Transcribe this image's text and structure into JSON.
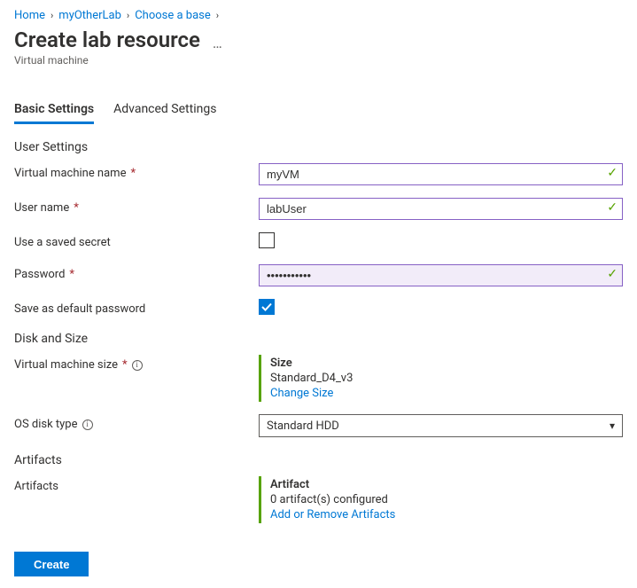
{
  "breadcrumb": {
    "home": "Home",
    "lab": "myOtherLab",
    "choose": "Choose a base"
  },
  "page": {
    "title": "Create lab resource",
    "subtitle": "Virtual machine"
  },
  "tabs": {
    "basic": "Basic Settings",
    "advanced": "Advanced Settings"
  },
  "sections": {
    "user_settings": "User Settings",
    "disk_size": "Disk and Size",
    "artifacts": "Artifacts"
  },
  "labels": {
    "vm_name": "Virtual machine name",
    "user_name": "User name",
    "use_saved_secret": "Use a saved secret",
    "password": "Password",
    "save_default_pw": "Save as default password",
    "vm_size": "Virtual machine size",
    "os_disk_type": "OS disk type",
    "artifacts": "Artifacts"
  },
  "values": {
    "vm_name": "myVM",
    "user_name": "labUser",
    "password": "•••••••••••",
    "use_saved_secret_checked": false,
    "save_default_pw_checked": true
  },
  "size_card": {
    "title": "Size",
    "value": "Standard_D4_v3",
    "action": "Change Size"
  },
  "os_disk": {
    "selected": "Standard HDD"
  },
  "artifact_card": {
    "title": "Artifact",
    "value": "0 artifact(s) configured",
    "action": "Add or Remove Artifacts"
  },
  "buttons": {
    "create": "Create"
  }
}
